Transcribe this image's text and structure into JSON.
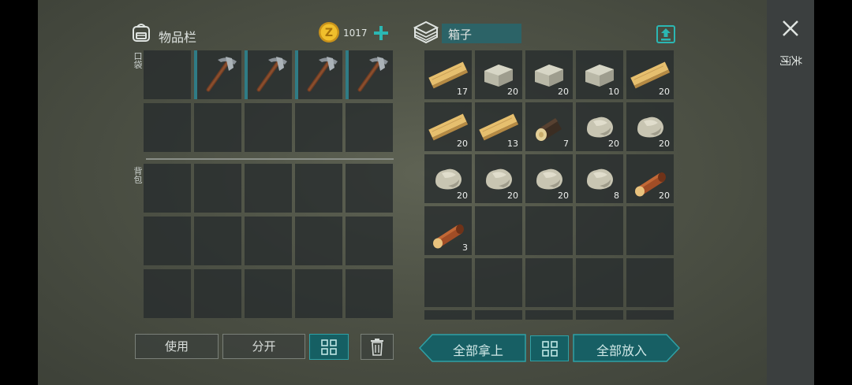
{
  "inventory": {
    "title": "物品栏",
    "coins": "1017",
    "coin_symbol": "Z",
    "pocket_label": "口袋",
    "backpack_label": "背包",
    "pocket_items": [
      "pickaxe",
      "pickaxe",
      "pickaxe",
      "pickaxe"
    ]
  },
  "box": {
    "name": "箱子",
    "items": [
      {
        "item": "plank",
        "qty": "17"
      },
      {
        "item": "stone-block",
        "qty": "20"
      },
      {
        "item": "stone-block",
        "qty": "20"
      },
      {
        "item": "stone-block",
        "qty": "10"
      },
      {
        "item": "plank",
        "qty": "20"
      },
      {
        "item": "plank",
        "qty": "20"
      },
      {
        "item": "plank",
        "qty": "13"
      },
      {
        "item": "log-dark",
        "qty": "7"
      },
      {
        "item": "stone",
        "qty": "20"
      },
      {
        "item": "stone",
        "qty": "20"
      },
      {
        "item": "stone",
        "qty": "20"
      },
      {
        "item": "stone",
        "qty": "20"
      },
      {
        "item": "stone",
        "qty": "20"
      },
      {
        "item": "stone",
        "qty": "8"
      },
      {
        "item": "log",
        "qty": "20"
      },
      {
        "item": "log",
        "qty": "3"
      }
    ]
  },
  "buttons": {
    "use": "使用",
    "split": "分开",
    "take_all": "全部拿上",
    "put_all": "全部放入"
  },
  "close_label": "关闭",
  "icons": {
    "backpack": "backpack-icon",
    "coin": "coin-icon",
    "add": "add-icon",
    "box": "box-icon",
    "upload": "upload-icon",
    "close": "close-icon",
    "sort": "grid-sort-icon",
    "trash": "trash-icon"
  },
  "colors": {
    "accent": "#1b6f72",
    "accent_border": "#2fa1a6",
    "slot": "#262c2d",
    "coin": "#d7a11c"
  }
}
